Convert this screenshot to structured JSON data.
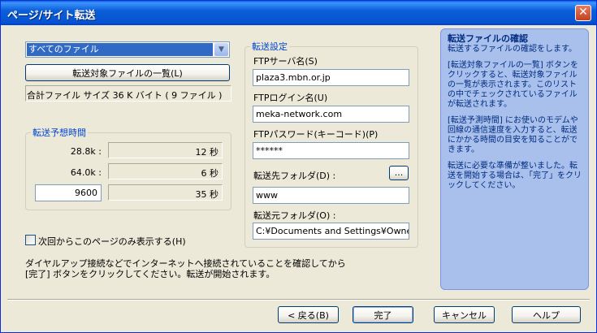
{
  "window": {
    "title": "ページ/サイト転送",
    "close_glyph": "✕"
  },
  "file_select": {
    "value": "すべてのファイル",
    "arrow": "▼"
  },
  "list_button": "転送対象ファイルの一覧(L)",
  "total_files": "合計ファイル サイズ 36 K バイト ( 9 ファイル )",
  "time_group": {
    "title": "転送予想時間",
    "rows": [
      {
        "speed": "28.8k :",
        "time": "12 秒"
      },
      {
        "speed": "64.0k :",
        "time": "6 秒"
      }
    ],
    "custom_speed": "9600",
    "custom_time": "35 秒"
  },
  "checkbox_label": "次回からこのページのみ表示する(H)",
  "note": [
    "ダイヤルアップ接続などでインターネットへ接続されていることを確認してから",
    "[完了] ボタンをクリックしてください。転送が開始されます。"
  ],
  "transfer": {
    "title": "転送設定",
    "server_label": "FTPサーバ名(S)",
    "server_value": "plaza3.mbn.or.jp",
    "login_label": "FTPログイン名(U)",
    "login_value": "meka-network.com",
    "password_label": "FTPパスワード(キーコード)(P)",
    "password_value": "******",
    "dest_label": "転送先フォルダ(D) :",
    "browse": "...",
    "dest_value": "www",
    "src_label": "転送元フォルダ(O) :",
    "src_value": "C:¥Documents and Settings¥Owner¥l"
  },
  "info": {
    "title": "転送ファイルの確認",
    "paragraphs": [
      "転送するファイルの確認をします。",
      "[転送対象ファイルの一覧] ボタンをクリックすると、転送対象ファイルの一覧が表示されます。このリストの中でチェックされているファイルが転送されます。",
      "[転送予測時間] にお使いのモデムや回線の通信速度を入力すると、転送にかかる時間の目安を知ることができます。",
      "転送に必要な準備が整いました。転送を開始する場合は、「完了」をクリックしてください。"
    ]
  },
  "buttons": {
    "back": "< 戻る(B)",
    "finish": "完了",
    "cancel": "キャンセル",
    "help": "ヘルプ"
  }
}
